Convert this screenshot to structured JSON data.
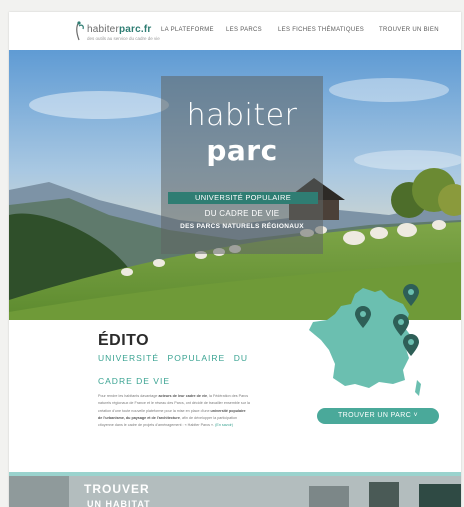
{
  "header": {
    "logo_light": "habiter",
    "logo_bold": "parc.fr",
    "logo_tagline": "des outils au service du cadre de vie",
    "nav": [
      "LA PLATEFORME",
      "LES PARCS",
      "LES FICHES THÉMATIQUES",
      "TROUVER UN BIEN"
    ]
  },
  "hero": {
    "title_light": "habiter",
    "title_bold": "parc",
    "band": "UNIVERSITÉ POPULAIRE",
    "line2": "DU CADRE DE VIE",
    "line3": "DES PARCS NATURELS RÉGIONAUX"
  },
  "edito": {
    "title": "ÉDITO",
    "subtitle": "UNIVERSITÉ POPULAIRE DU",
    "subtitle2": "CADRE DE VIE",
    "body_1": "Pour rendre les habitants davantage ",
    "body_b1": "acteurs de leur cadre de vie",
    "body_2": ", la Fédération des Parcs naturels régionaux de France et le réseau des Parcs, ont décidé de travailler ensemble sur la création d'une toute nouvelle plateforme pour la mise en place d'une ",
    "body_b2": "université populaire de l'urbanisme, du paysage et de l'architecture",
    "body_3": ", afin de développer la participation citoyenne dans le cadre de projets d'aménagement : « Habiter Parcs ». ",
    "body_link": "(En savoir)"
  },
  "cta": {
    "find_parc": "TROUVER UN PARC ˅"
  },
  "bottom": {
    "title": "TROUVER",
    "subtitle": "UN HABITAT"
  },
  "colors": {
    "accent": "#2f7d73",
    "accent_light": "#4aa99a",
    "map": "#6bbfb0",
    "pin": "#2e5f57"
  }
}
